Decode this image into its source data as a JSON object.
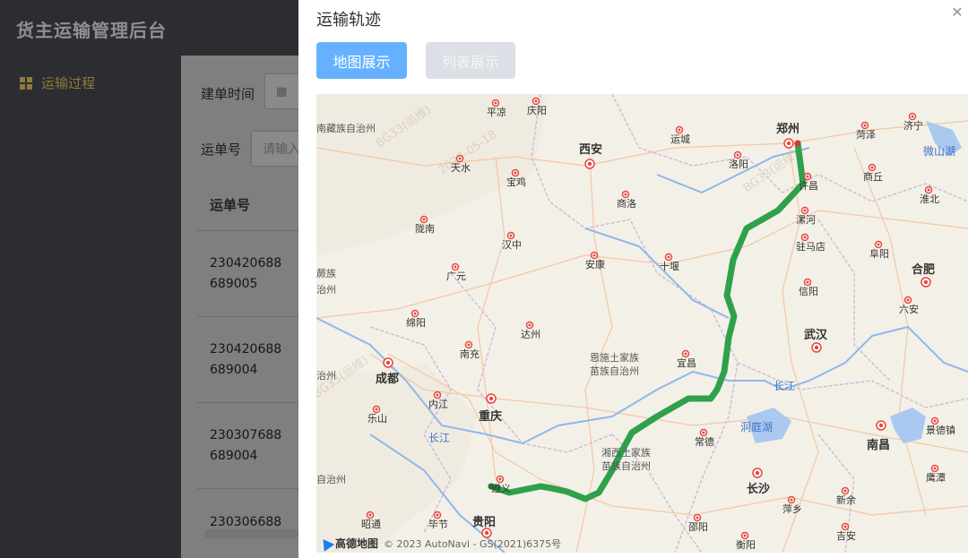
{
  "app": {
    "title": "货主运输管理后台"
  },
  "sidebar": {
    "items": [
      {
        "label": "运输过程",
        "icon": "grid-icon"
      }
    ]
  },
  "filters": {
    "create_time_label": "建单时间",
    "create_time_icon": "calendar-icon",
    "waybill_label": "运单号",
    "waybill_placeholder": "请输入"
  },
  "table": {
    "columns": [
      "运单号"
    ],
    "rows": [
      {
        "waybill_line1": "230420688",
        "waybill_line2": "689005"
      },
      {
        "waybill_line1": "230420688",
        "waybill_line2": "689004"
      },
      {
        "waybill_line1": "230307688",
        "waybill_line2": "689004"
      },
      {
        "waybill_line1": "230306688",
        "waybill_line2": ""
      }
    ]
  },
  "modal": {
    "title": "运输轨迹",
    "close_icon": "close-icon",
    "tabs": [
      {
        "label": "地图展示",
        "active": true
      },
      {
        "label": "列表展示",
        "active": false
      }
    ]
  },
  "map": {
    "provider_logo": "高德地图",
    "attribution": "© 2023 AutoNavi - GS(2021)6375号",
    "route_color": "#2fa14a",
    "cities": [
      {
        "name": "郑州",
        "major": true
      },
      {
        "name": "西安",
        "major": true
      },
      {
        "name": "武汉",
        "major": true
      },
      {
        "name": "成都",
        "major": true
      },
      {
        "name": "重庆",
        "major": true
      },
      {
        "name": "长沙",
        "major": true
      },
      {
        "name": "南昌",
        "major": true
      },
      {
        "name": "合肥",
        "major": true
      },
      {
        "name": "贵阳",
        "major": true
      },
      {
        "name": "平凉"
      },
      {
        "name": "庆阳"
      },
      {
        "name": "运城"
      },
      {
        "name": "洛阳"
      },
      {
        "name": "天水"
      },
      {
        "name": "宝鸡"
      },
      {
        "name": "商洛"
      },
      {
        "name": "许昌"
      },
      {
        "name": "漯河"
      },
      {
        "name": "驻马店"
      },
      {
        "name": "陇南"
      },
      {
        "name": "汉中"
      },
      {
        "name": "安康"
      },
      {
        "name": "十堰"
      },
      {
        "name": "信阳"
      },
      {
        "name": "广元"
      },
      {
        "name": "绵阳"
      },
      {
        "name": "南充"
      },
      {
        "name": "达州"
      },
      {
        "name": "宜昌"
      },
      {
        "name": "内江"
      },
      {
        "name": "乐山"
      },
      {
        "name": "常德"
      },
      {
        "name": "萍乡"
      },
      {
        "name": "新余"
      },
      {
        "name": "吉安"
      },
      {
        "name": "景德镇"
      },
      {
        "name": "鹰潭"
      },
      {
        "name": "邵阳"
      },
      {
        "name": "衡阳"
      },
      {
        "name": "毕节"
      },
      {
        "name": "昭通"
      },
      {
        "name": "商丘"
      },
      {
        "name": "菏泽"
      },
      {
        "name": "济宁"
      },
      {
        "name": "淮北"
      },
      {
        "name": "阜阳"
      },
      {
        "name": "六安"
      },
      {
        "name": "遵义"
      }
    ],
    "regions": [
      {
        "name": "甘南藏族自治州"
      },
      {
        "name": "恩施土家族苗族自治州"
      },
      {
        "name": "湘西土家族苗族自治州"
      },
      {
        "name": "洞庭湖"
      },
      {
        "name": "微山湖"
      },
      {
        "name": "长江"
      }
    ]
  }
}
